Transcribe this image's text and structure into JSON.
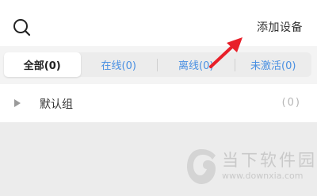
{
  "header": {
    "search_icon": "search-icon",
    "add_device_label": "添加设备"
  },
  "tabs": [
    {
      "label": "全部(0)",
      "active": true
    },
    {
      "label": "在线(0)",
      "active": false
    },
    {
      "label": "离线(0)",
      "active": false
    },
    {
      "label": "未激活(0)",
      "active": false
    }
  ],
  "group": {
    "expand_icon": "triangle-right-icon",
    "name": "默认组",
    "count": "(0)"
  },
  "watermark": {
    "title": "当下软件园",
    "url": "www.downxia.com"
  },
  "colors": {
    "accent": "#4a90e2",
    "annotation_arrow": "#e8202a",
    "background": "#ededed"
  }
}
